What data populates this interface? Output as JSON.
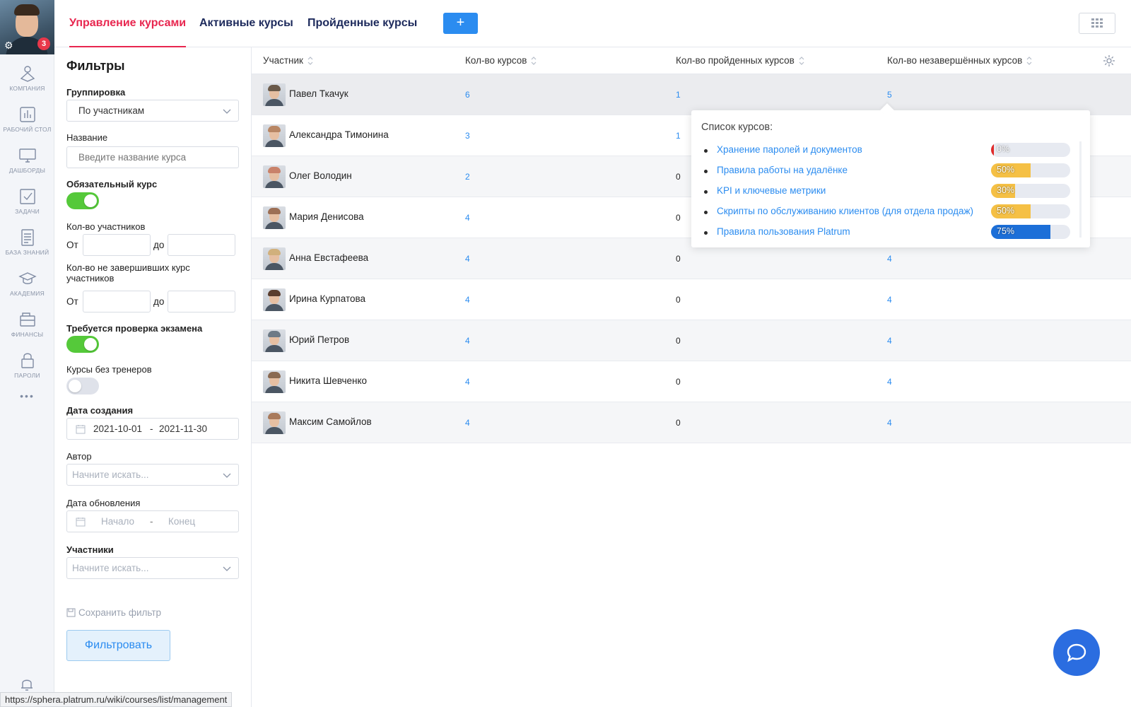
{
  "sidebar": {
    "avatar_badge": "3",
    "items": [
      {
        "label": "КОМПАНИЯ",
        "icon": "company-icon"
      },
      {
        "label": "РАБОЧИЙ СТОЛ",
        "icon": "chart-icon"
      },
      {
        "label": "ДАШБОРДЫ",
        "icon": "monitor-icon"
      },
      {
        "label": "ЗАДАЧИ",
        "icon": "checkbox-icon"
      },
      {
        "label": "БАЗА ЗНАНИЙ",
        "icon": "document-icon"
      },
      {
        "label": "АКАДЕМИЯ",
        "icon": "graduation-cap-icon"
      },
      {
        "label": "ФИНАНСЫ",
        "icon": "wallet-icon"
      },
      {
        "label": "ПАРОЛИ",
        "icon": "lock-icon"
      }
    ],
    "more": "•••"
  },
  "tabs": [
    {
      "label": "Управление курсами",
      "active": true
    },
    {
      "label": "Активные курсы",
      "active": false
    },
    {
      "label": "Пройденные курсы",
      "active": false
    }
  ],
  "toolbar": {
    "add_label": "+"
  },
  "filters": {
    "title": "Фильтры",
    "grouping_label": "Группировка",
    "grouping_value": "По участникам",
    "name_label": "Название",
    "name_placeholder": "Введите название курса",
    "mandatory_label": "Обязательный курс",
    "mandatory_on": true,
    "participants_count_label": "Кол-во участников",
    "from_label": "От",
    "to_label": "до",
    "unfinished_label": "Кол-во не завершивших курс участников",
    "exam_label": "Требуется проверка экзамена",
    "exam_on": true,
    "no_trainers_label": "Курсы без тренеров",
    "no_trainers_on": false,
    "created_label": "Дата создания",
    "created_from": "2021-10-01",
    "created_to": "2021-11-30",
    "date_separator": "-",
    "author_label": "Автор",
    "author_placeholder": "Начните искать...",
    "updated_label": "Дата обновления",
    "updated_from_placeholder": "Начало",
    "updated_to_placeholder": "Конец",
    "participants_label": "Участники",
    "participants_placeholder": "Начните искать...",
    "save_filter": "Сохранить фильтр",
    "filter_button": "Фильтровать"
  },
  "table": {
    "columns": [
      "Участник",
      "Кол-во курсов",
      "Кол-во пройденных курсов",
      "Кол-во незавершённых курсов"
    ],
    "rows": [
      {
        "name": "Павел Ткачук",
        "courses": "6",
        "passed": "1",
        "unfinished": "5"
      },
      {
        "name": "Александра Тимонина",
        "courses": "3",
        "passed": "1",
        "unfinished": ""
      },
      {
        "name": "Олег Володин",
        "courses": "2",
        "passed": "0",
        "unfinished": ""
      },
      {
        "name": "Мария Денисова",
        "courses": "4",
        "passed": "0",
        "unfinished": ""
      },
      {
        "name": "Анна Евстафеева",
        "courses": "4",
        "passed": "0",
        "unfinished": "4"
      },
      {
        "name": "Ирина Курпатова",
        "courses": "4",
        "passed": "0",
        "unfinished": "4"
      },
      {
        "name": "Юрий Петров",
        "courses": "4",
        "passed": "0",
        "unfinished": "4"
      },
      {
        "name": "Никита Шевченко",
        "courses": "4",
        "passed": "0",
        "unfinished": "4"
      },
      {
        "name": "Максим Самойлов",
        "courses": "4",
        "passed": "0",
        "unfinished": "4"
      }
    ]
  },
  "popover": {
    "title": "Список курсов:",
    "items": [
      {
        "name": "Хранение паролей и документов",
        "progress": 0,
        "label": "0%"
      },
      {
        "name": "Правила работы на удалёнке",
        "progress": 50,
        "label": "50%"
      },
      {
        "name": "KPI и ключевые метрики",
        "progress": 30,
        "label": "30%"
      },
      {
        "name": "Скрипты по обслуживанию клиентов (для отдела продаж)",
        "progress": 50,
        "label": "50%"
      },
      {
        "name": "Правила пользования Platrum",
        "progress": 75,
        "label": "75%"
      }
    ]
  },
  "colors": {
    "accent": "#e8264f",
    "link": "#2b8cf0",
    "toggle_on": "#55c93a",
    "progress_mid": "#f5c045",
    "progress_high": "#1c6fd8",
    "progress_zero": "#e02a2a"
  },
  "status_url": "https://sphera.platrum.ru/wiki/courses/list/management"
}
